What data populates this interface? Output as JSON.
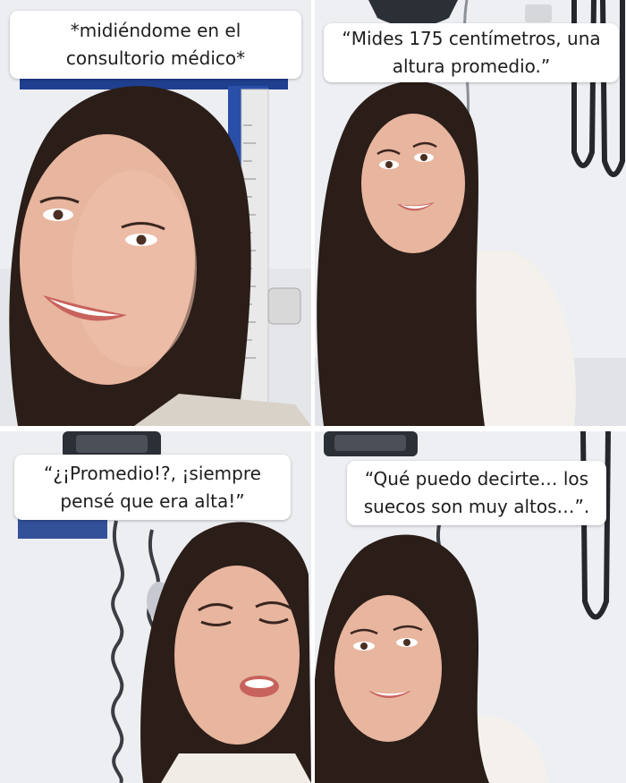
{
  "panels": [
    {
      "caption_lines": [
        "*midiéndome en el",
        "consultorio médico*"
      ]
    },
    {
      "caption_lines": [
        "“Mides 175 centímetros, una",
        "altura promedio.”"
      ]
    },
    {
      "caption_lines": [
        "“¿¡Promedio!?, ¡siempre",
        "pensé que era alta!”"
      ]
    },
    {
      "caption_lines": [
        "“Qué puedo decirte… los",
        "suecos son muy altos…”."
      ]
    }
  ],
  "colors": {
    "wall": "#eceef2",
    "hair": "#2b1d18",
    "skin": "#e8b59e",
    "lips": "#c8625c",
    "shirt": "#f4f1ec",
    "stadiometer_blue": "#1f3f8f",
    "cable": "#3a3d44"
  }
}
